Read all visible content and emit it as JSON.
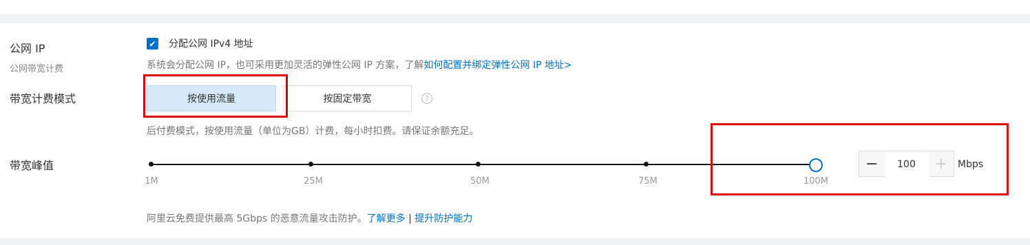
{
  "public_ip": {
    "label": "公网 IP",
    "sub_label": "公网带宽计费",
    "checkbox_label": "分配公网 IPv4 地址",
    "checked": true,
    "description": "系统会分配公网 IP，也可采用更加灵活的弹性公网 IP 方案，了解",
    "description_link": "如何配置并绑定弹性公网 IP 地址>"
  },
  "billing_mode": {
    "label": "带宽计费模式",
    "options": [
      "按使用流量",
      "按固定带宽"
    ],
    "selected": "按使用流量",
    "help_icon": "?",
    "description": "后付费模式，按使用流量（单位为GB）计费，每小时扣费。请保证余额充足。"
  },
  "bandwidth_peak": {
    "label": "带宽峰值",
    "slider": {
      "ticks": [
        "1M",
        "25M",
        "50M",
        "75M",
        "100M"
      ],
      "value": 100
    },
    "stepper": {
      "minus": "−",
      "value": "100",
      "plus": "+",
      "unit": "Mbps"
    }
  },
  "protection": {
    "text": "阿里云免费提供最高 5Gbps 的恶意流量攻击防护。",
    "learn_more": "了解更多",
    "separator": "|",
    "upgrade": "提升防护能力"
  },
  "colors": {
    "accent": "#0070cc",
    "highlight": "#e00000",
    "selected_bg": "#d4e9f8"
  }
}
